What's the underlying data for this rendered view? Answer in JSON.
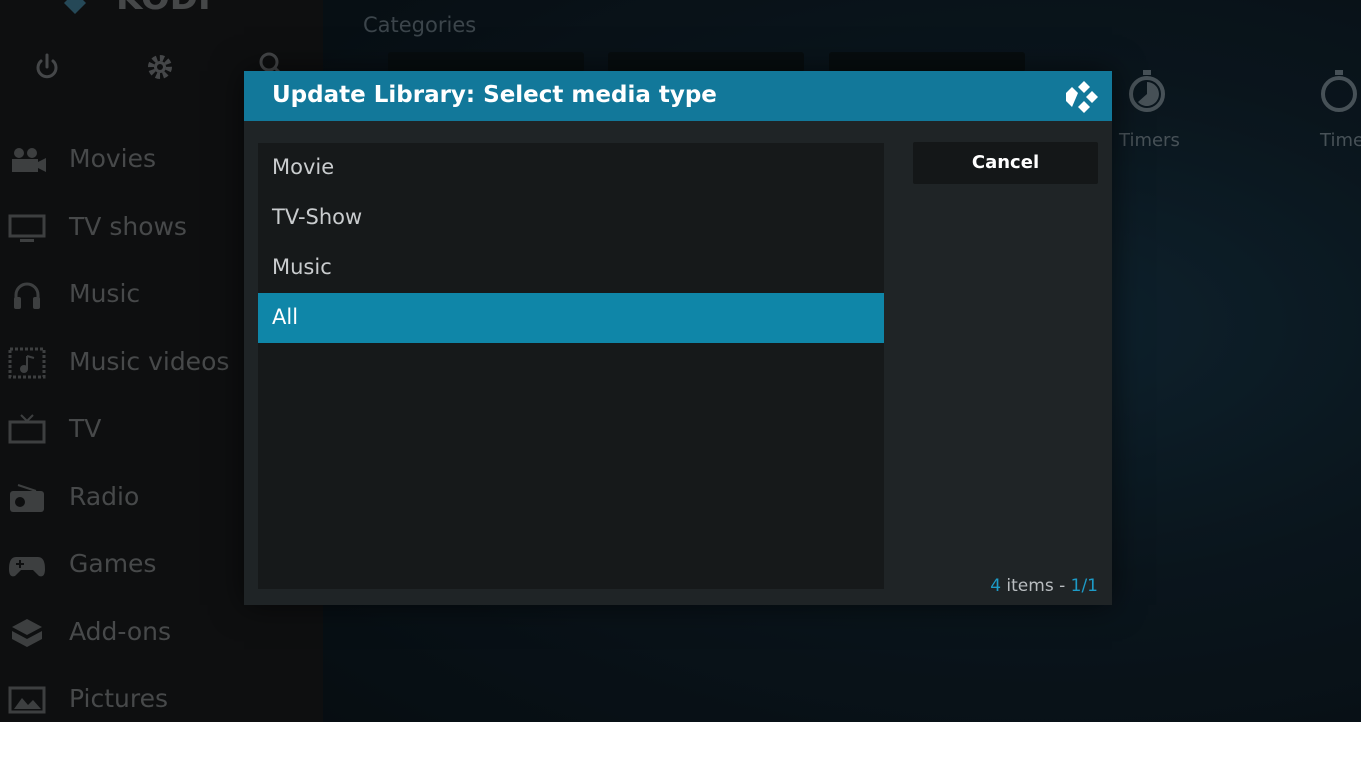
{
  "app": {
    "logo_text": "KODI"
  },
  "sidebar": {
    "items": [
      {
        "label": "Movies",
        "icon": "movie-camera-icon"
      },
      {
        "label": "TV shows",
        "icon": "monitor-icon"
      },
      {
        "label": "Music",
        "icon": "headphones-icon"
      },
      {
        "label": "Music videos",
        "icon": "music-video-icon"
      },
      {
        "label": "TV",
        "icon": "tv-icon"
      },
      {
        "label": "Radio",
        "icon": "radio-icon"
      },
      {
        "label": "Games",
        "icon": "gamepad-icon"
      },
      {
        "label": "Add-ons",
        "icon": "addons-box-icon"
      },
      {
        "label": "Pictures",
        "icon": "picture-icon"
      }
    ]
  },
  "main": {
    "section_title": "Categories",
    "timers": [
      {
        "label": "Timers"
      },
      {
        "label": "Time"
      }
    ]
  },
  "dialog": {
    "title": "Update Library: Select media type",
    "options": [
      {
        "label": "Movie",
        "selected": false
      },
      {
        "label": "TV-Show",
        "selected": false
      },
      {
        "label": "Music",
        "selected": false
      },
      {
        "label": "All",
        "selected": true
      }
    ],
    "cancel_label": "Cancel",
    "footer": {
      "count": "4",
      "count_suffix": " items - ",
      "page": "1/1"
    }
  },
  "colors": {
    "accent": "#12789a",
    "selected": "#0f86a8",
    "highlight_text": "#1d9bc7"
  }
}
